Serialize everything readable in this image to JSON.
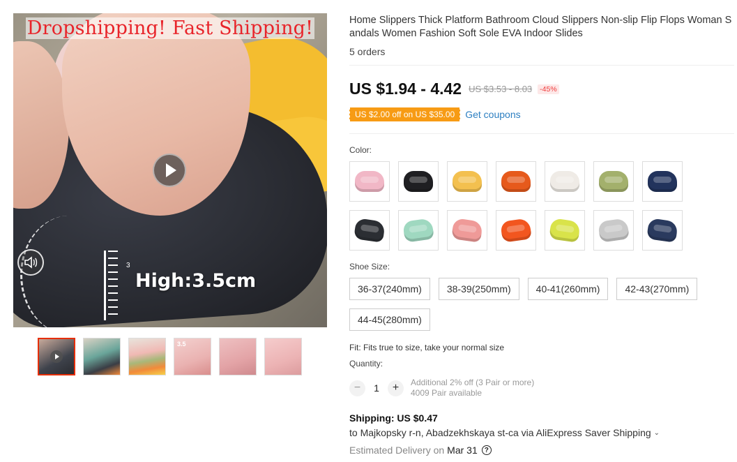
{
  "gallery": {
    "overlay_title": "Dropshipping! Fast Shipping!",
    "measure_label": "High:3.5cm",
    "ruler_number": "3",
    "thumb_label": "3.5",
    "play_icon": "play-icon",
    "volume_icon": "volume-icon",
    "thumb_colors": [
      "#4b4f58",
      "#6aa59a",
      "#f28a3a",
      "#f0c4c2",
      "#e9b6b8",
      "#f1bfc0"
    ]
  },
  "product": {
    "title": "Home Slippers Thick Platform Bathroom Cloud Slippers Non-slip Flip Flops Woman Sandals Women Fashion Soft Sole EVA Indoor Slides",
    "orders": "5 orders",
    "price": "US $1.94 - 4.42",
    "old_price": "US $3.53 - 8.03",
    "discount": "-45%",
    "coupon": "US $2.00 off on US $35.00",
    "coupon_link": "Get coupons"
  },
  "color": {
    "label": "Color:",
    "swatches": [
      "#f1b7c6",
      "#1f1f22",
      "#f3c04f",
      "#e65a1c",
      "#efebe6",
      "#a3b06c",
      "#22335c",
      "#2b2e33",
      "#9fd8c0",
      "#ef9a98",
      "#f2561f",
      "#d9e34a",
      "#c9c9c9",
      "#2a3a5e"
    ]
  },
  "size": {
    "label": "Shoe Size:",
    "options": [
      "36-37(240mm)",
      "38-39(250mm)",
      "40-41(260mm)",
      "42-43(270mm)",
      "44-45(280mm)"
    ]
  },
  "fit": "Fit: Fits true to size, take your normal size",
  "quantity": {
    "label": "Quantity:",
    "value": "1",
    "minus": "−",
    "plus": "+",
    "offer": "Additional 2% off (3 Pair or more)",
    "available": "4009 Pair available"
  },
  "shipping": {
    "title": "Shipping: US $0.47",
    "destination": "to Majkopsky r-n, Abadzekhskaya st-ca via AliExpress Saver Shipping",
    "chevron": "⌄",
    "delivery_label": "Estimated Delivery on",
    "delivery_date": "Mar 31",
    "help": "?"
  }
}
